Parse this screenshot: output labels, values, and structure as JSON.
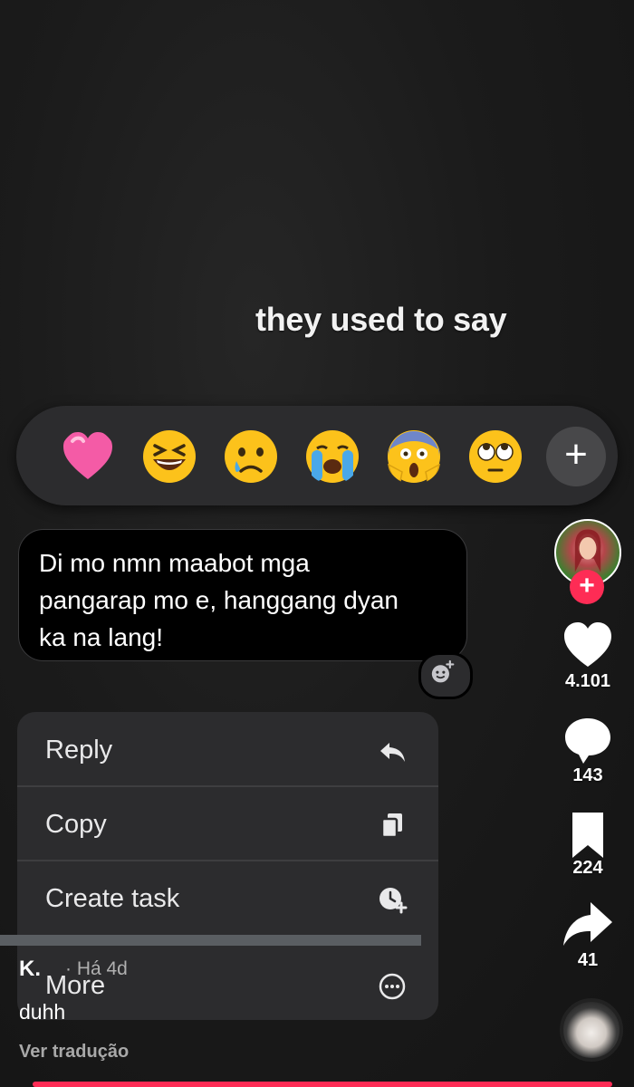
{
  "overlay_text": "they used to say",
  "reactions": {
    "emojis": [
      "pink-heart",
      "laughing-squint",
      "crying-tear",
      "loudly-crying",
      "screaming-fear",
      "eye-roll"
    ],
    "more_symbol": "+"
  },
  "message": {
    "lines": [
      "Di mo nmn maabot mga",
      "pangarap mo e, hanggang dyan",
      "ka na lang!"
    ]
  },
  "menu": {
    "items": [
      {
        "label": "Reply",
        "icon": "reply-arrow-icon"
      },
      {
        "label": "Copy",
        "icon": "copy-icon"
      },
      {
        "label": "Create task",
        "icon": "clock-plus-icon"
      },
      {
        "label": "More",
        "icon": "ellipsis-circle-icon"
      }
    ]
  },
  "rail": {
    "follow_symbol": "+",
    "likes": "4.101",
    "comments": "143",
    "saves": "224",
    "shares": "41"
  },
  "caption": {
    "username": "K.",
    "time": "· Há 4d",
    "text": "duhh",
    "translate": "Ver tradução"
  },
  "colors": {
    "accent": "#fe2c55",
    "menu_bg": "#2c2c2e",
    "bubble_bg": "#000000"
  }
}
